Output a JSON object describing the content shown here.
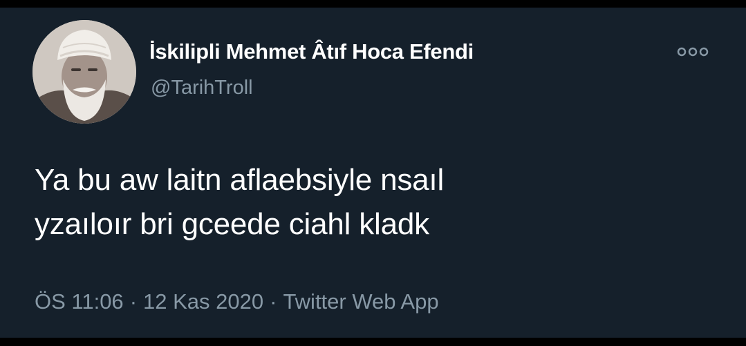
{
  "tweet": {
    "author": {
      "display_name": "İskilipli Mehmet Âtıf Hoca Efendi",
      "handle": "@TarihTroll"
    },
    "text_lines": [
      "Ya bu aw laitn aflaebsiyle nsaıl",
      "yzaıloır bri gceede ciahl kladk"
    ],
    "meta": {
      "time": "ÖS 11:06",
      "date": "12 Kas 2020",
      "source": "Twitter Web App",
      "separator": "·"
    },
    "more_icon": "more-options-icon"
  },
  "colors": {
    "background": "#15202b",
    "text": "#ffffff",
    "secondary_text": "#8899a6",
    "frame": "#000000"
  }
}
